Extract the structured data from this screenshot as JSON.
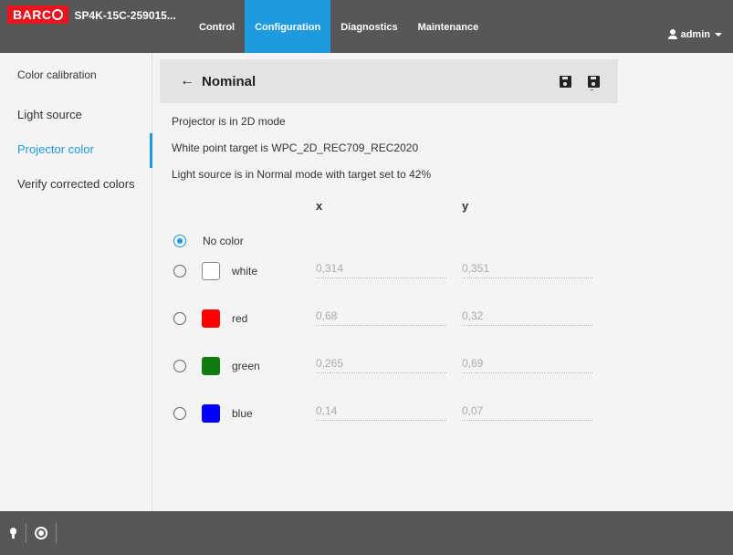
{
  "header": {
    "logo_text": "BARC",
    "device_name": "SP4K-15C-259015...",
    "tabs": [
      {
        "label": "Control"
      },
      {
        "label": "Configuration"
      },
      {
        "label": "Diagnostics"
      },
      {
        "label": "Maintenance"
      }
    ],
    "active_tab": "Configuration",
    "user": "admin"
  },
  "sidebar": {
    "heading": "Color calibration",
    "items": [
      {
        "label": "Light source"
      },
      {
        "label": "Projector color"
      },
      {
        "label": "Verify corrected colors"
      }
    ],
    "active_item": "Projector color"
  },
  "main": {
    "title": "Nominal",
    "info": [
      "Projector is in 2D mode",
      "White point target is WPC_2D_REC709_REC2020",
      "Light source is in Normal mode with target set to 42%"
    ],
    "columns": {
      "x": "x",
      "y": "y"
    },
    "no_color_label": "No color",
    "colors": [
      {
        "name": "white",
        "swatch": "#ffffff",
        "x": "0,314",
        "y": "0,351"
      },
      {
        "name": "red",
        "swatch": "#ff0000",
        "x": "0,68",
        "y": "0,32"
      },
      {
        "name": "green",
        "swatch": "#107c10",
        "x": "0,265",
        "y": "0,69"
      },
      {
        "name": "blue",
        "swatch": "#0000ff",
        "x": "0,14",
        "y": "0,07"
      }
    ],
    "selected": "No color"
  },
  "colors": {
    "accent": "#1e9be0",
    "bar": "#575757",
    "brand": "#e8141e"
  }
}
